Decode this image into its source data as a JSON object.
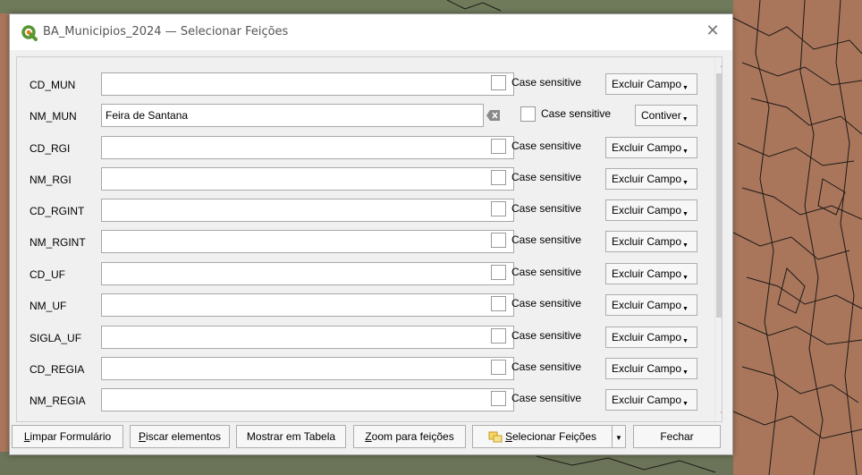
{
  "window": {
    "title": "BA_Municipios_2024 — Selecionar Feições",
    "close_glyph": "✕",
    "icon": "qgis-logo-icon"
  },
  "fields": [
    {
      "name": "CD_MUN",
      "value": "",
      "case_label": "Case sensitive",
      "mode": "Excluir Campo"
    },
    {
      "name": "NM_MUN",
      "value": "Feira de Santana",
      "case_label": "Case sensitive",
      "mode": "Contiver"
    },
    {
      "name": "CD_RGI",
      "value": "",
      "case_label": "Case sensitive",
      "mode": "Excluir Campo"
    },
    {
      "name": "NM_RGI",
      "value": "",
      "case_label": "Case sensitive",
      "mode": "Excluir Campo"
    },
    {
      "name": "CD_RGINT",
      "value": "",
      "case_label": "Case sensitive",
      "mode": "Excluir Campo"
    },
    {
      "name": "NM_RGINT",
      "value": "",
      "case_label": "Case sensitive",
      "mode": "Excluir Campo"
    },
    {
      "name": "CD_UF",
      "value": "",
      "case_label": "Case sensitive",
      "mode": "Excluir Campo"
    },
    {
      "name": "NM_UF",
      "value": "",
      "case_label": "Case sensitive",
      "mode": "Excluir Campo"
    },
    {
      "name": "SIGLA_UF",
      "value": "",
      "case_label": "Case sensitive",
      "mode": "Excluir Campo"
    },
    {
      "name": "CD_REGIA",
      "value": "",
      "case_label": "Case sensitive",
      "mode": "Excluir Campo"
    },
    {
      "name": "NM_REGIA",
      "value": "",
      "case_label": "Case sensitive",
      "mode": "Excluir Campo"
    }
  ],
  "buttons": {
    "clear_form": {
      "mnemonic": "L",
      "rest": "impar Formulário"
    },
    "flash": {
      "mnemonic": "P",
      "rest": "iscar elementos"
    },
    "show_table": "Mostrar em Tabela",
    "zoom": {
      "mnemonic": "Z",
      "rest": "oom para feições"
    },
    "select": {
      "mnemonic": "S",
      "rest": "elecionar Feições"
    },
    "close": "Fechar"
  },
  "colors": {
    "map_fill": "#a9765b",
    "qgis_green": "#589632"
  }
}
